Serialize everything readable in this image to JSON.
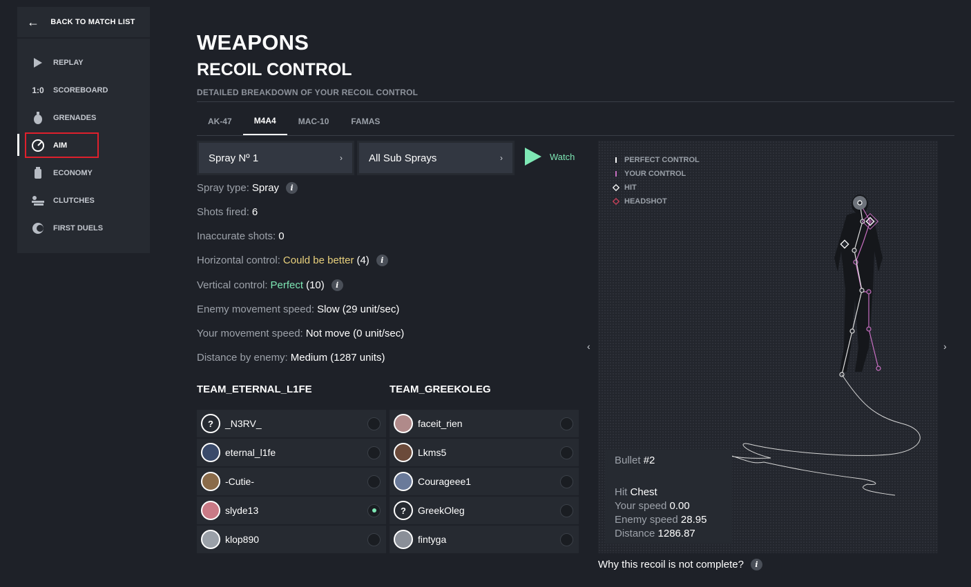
{
  "sidebar": {
    "back_label": "BACK TO MATCH LIST",
    "items": [
      {
        "label": "REPLAY",
        "icon": "play-icon"
      },
      {
        "label": "SCOREBOARD",
        "icon": "scoreboard-icon",
        "icon_text": "1:0"
      },
      {
        "label": "GRENADES",
        "icon": "grenade-icon"
      },
      {
        "label": "AIM",
        "icon": "aim-icon",
        "active": true
      },
      {
        "label": "ECONOMY",
        "icon": "economy-icon"
      },
      {
        "label": "CLUTCHES",
        "icon": "clutches-icon"
      },
      {
        "label": "FIRST DUELS",
        "icon": "first-duels-icon"
      }
    ]
  },
  "header": {
    "title": "WEAPONS",
    "subtitle": "RECOIL CONTROL",
    "description": "DETAILED BREAKDOWN OF YOUR RECOIL CONTROL"
  },
  "tabs": [
    {
      "label": "AK-47"
    },
    {
      "label": "M4A4",
      "active": true
    },
    {
      "label": "MAC-10"
    },
    {
      "label": "FAMAS"
    }
  ],
  "controls": {
    "spray_select": "Spray Nº 1",
    "sub_spray_select": "All Sub Sprays",
    "watch_label": "Watch"
  },
  "stats": {
    "spray_type_label": "Spray type:",
    "spray_type_value": "Spray",
    "shots_fired_label": "Shots fired:",
    "shots_fired_value": "6",
    "inaccurate_label": "Inaccurate shots:",
    "inaccurate_value": "0",
    "horizontal_label": "Horizontal control:",
    "horizontal_value": "Could be better",
    "horizontal_score": "(4)",
    "vertical_label": "Vertical control:",
    "vertical_value": "Perfect",
    "vertical_score": "(10)",
    "enemy_speed_label": "Enemy movement speed:",
    "enemy_speed_value": "Slow (29 unit/sec)",
    "your_speed_label": "Your movement speed:",
    "your_speed_value": "Not move (0 unit/sec)",
    "distance_label": "Distance by enemy:",
    "distance_value": "Medium (1287 units)"
  },
  "teams": [
    {
      "name": "TEAM_ETERNAL_L1FE",
      "players": [
        {
          "name": "_N3RV_",
          "avatar": "?",
          "color": "#262a31",
          "selected": false
        },
        {
          "name": "eternal_l1fe",
          "avatar": "",
          "color": "#3a4a6a",
          "selected": false
        },
        {
          "name": "-Cutie-",
          "avatar": "",
          "color": "#8a6b4a",
          "selected": false
        },
        {
          "name": "slyde13",
          "avatar": "",
          "color": "#c97a86",
          "selected": true
        },
        {
          "name": "klop890",
          "avatar": "",
          "color": "#9aa0a8",
          "selected": false
        }
      ]
    },
    {
      "name": "TEAM_GREEKOLEG",
      "players": [
        {
          "name": "faceit_rien",
          "avatar": "",
          "color": "#b08a8a",
          "selected": false
        },
        {
          "name": "Lkms5",
          "avatar": "",
          "color": "#6b4a3a",
          "selected": false
        },
        {
          "name": "Courageee1",
          "avatar": "",
          "color": "#6a7a9a",
          "selected": false
        },
        {
          "name": "GreekOleg",
          "avatar": "?",
          "color": "#262a31",
          "selected": false
        },
        {
          "name": "fintyga",
          "avatar": "",
          "color": "#8a8f98",
          "selected": false
        }
      ]
    }
  ],
  "legend": [
    {
      "label": "PERFECT CONTROL",
      "icon": "white-line-icon"
    },
    {
      "label": "YOUR CONTROL",
      "icon": "pink-line-icon"
    },
    {
      "label": "HIT",
      "icon": "white-diamond-icon"
    },
    {
      "label": "HEADSHOT",
      "icon": "pink-diamond-icon"
    }
  ],
  "bullet": {
    "title_label": "Bullet",
    "title_value": "#2",
    "hit_label": "Hit",
    "hit_value": "Chest",
    "your_speed_label": "Your speed",
    "your_speed_value": "0.00",
    "enemy_speed_label": "Enemy speed",
    "enemy_speed_value": "28.95",
    "distance_label": "Distance",
    "distance_value": "1286.87"
  },
  "nav": {
    "prev": "‹",
    "next": "›"
  },
  "footer": {
    "why_label": "Why this recoil is not complete?"
  },
  "colors": {
    "accent_green": "#7ee8b5",
    "warning_yellow": "#e8d07c",
    "your_control_pink": "#c86fc2",
    "headshot_red": "#d0405a",
    "highlight_red": "#e0202c"
  }
}
